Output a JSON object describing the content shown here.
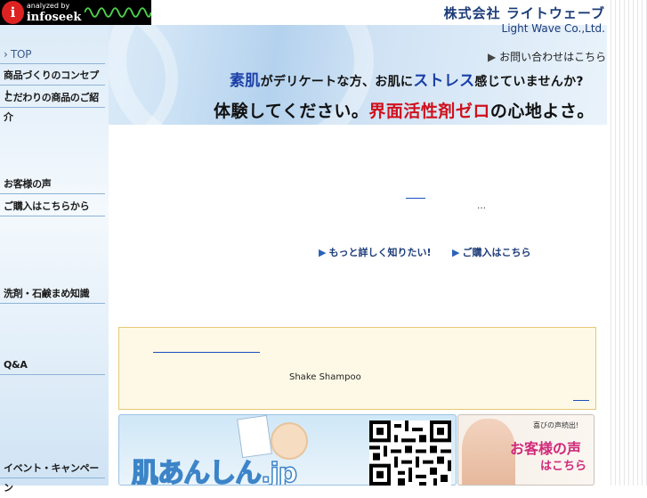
{
  "analytics": {
    "line1": "analyzed by",
    "line2": "infoseek"
  },
  "header": {
    "company_jp": "株式会社 ライトウェーブ",
    "company_en": "Light Wave Co.,Ltd.",
    "contact_link": "お問い合わせはこちら",
    "tagline1": {
      "part1": "素肌",
      "part2": "がデリケートな方、お肌に",
      "part3": "ストレス",
      "part4": "感じていませんか?"
    },
    "tagline2": {
      "part1": "体験してください。",
      "part2": "界面活性剤ゼロ",
      "part3": "の心地よさ。"
    }
  },
  "sidebar": {
    "items": [
      {
        "label": "TOP"
      },
      {
        "label": "商品づくりのコンセプト"
      },
      {
        "label": "こだわりの商品のご紹介"
      },
      {
        "label": "お客様の声"
      },
      {
        "label": "ご購入はこちらから"
      },
      {
        "label": "洗剤・石鹸まめ知識"
      },
      {
        "label": "Q&A"
      },
      {
        "label": "イベント・キャンペーン"
      }
    ]
  },
  "main": {
    "dots": "…",
    "link_more": "もっと詳しく知りたい!",
    "link_buy": "ご購入はこちら",
    "arrow_icon": "triangle-right-icon"
  },
  "notice": {
    "product": "Shake Shampoo"
  },
  "banners": {
    "left_logo": "肌あんしん.jp",
    "right_small": "喜びの声続出!",
    "right_big": "お客様の声",
    "right_here": "はこちら"
  },
  "colors": {
    "navy": "#1c3c78",
    "red": "#d0101c",
    "accent_blue": "#1b3fa8",
    "pink": "#d02a7a"
  }
}
